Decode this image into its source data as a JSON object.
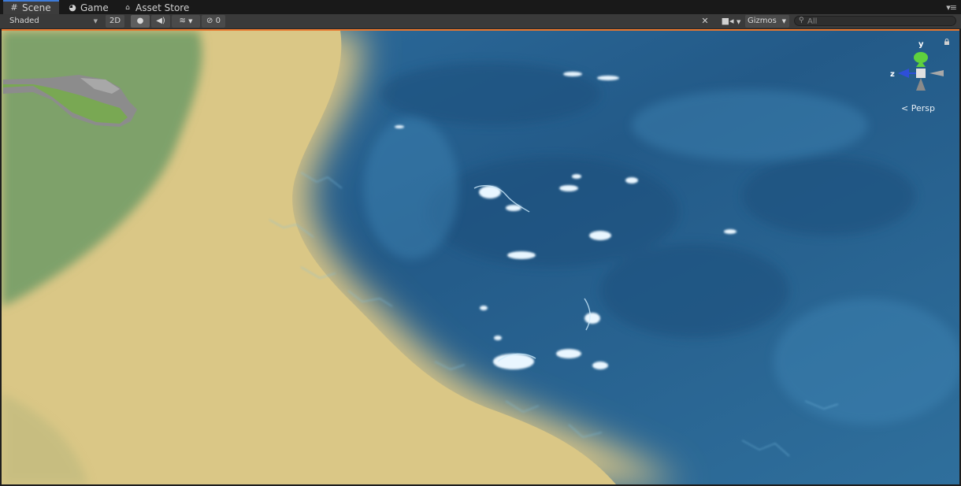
{
  "tabs": [
    {
      "label": "Scene",
      "icon": "grid-icon",
      "active": true
    },
    {
      "label": "Game",
      "icon": "pacman-icon",
      "active": false
    },
    {
      "label": "Asset Store",
      "icon": "bag-icon",
      "active": false
    }
  ],
  "toolbar": {
    "draw_mode": "Shaded",
    "mode_2d": "2D",
    "lighting_icon": "bulb-icon",
    "audio_icon": "speaker-icon",
    "effects_icon": "layers-icon",
    "hidden_count": "0",
    "tools_icon": "tools-icon",
    "camera_icon": "camera-icon",
    "gizmos_label": "Gizmos",
    "search_placeholder": "All"
  },
  "scene_gizmo": {
    "y_label": "y",
    "z_label": "z",
    "projection": "Persp"
  },
  "colors": {
    "active_tab_accent": "#3d7bd8",
    "viewport_border": "#e8772e",
    "water": "#2a6592",
    "sand": "#d8c486",
    "grass": "#7ea16a"
  }
}
